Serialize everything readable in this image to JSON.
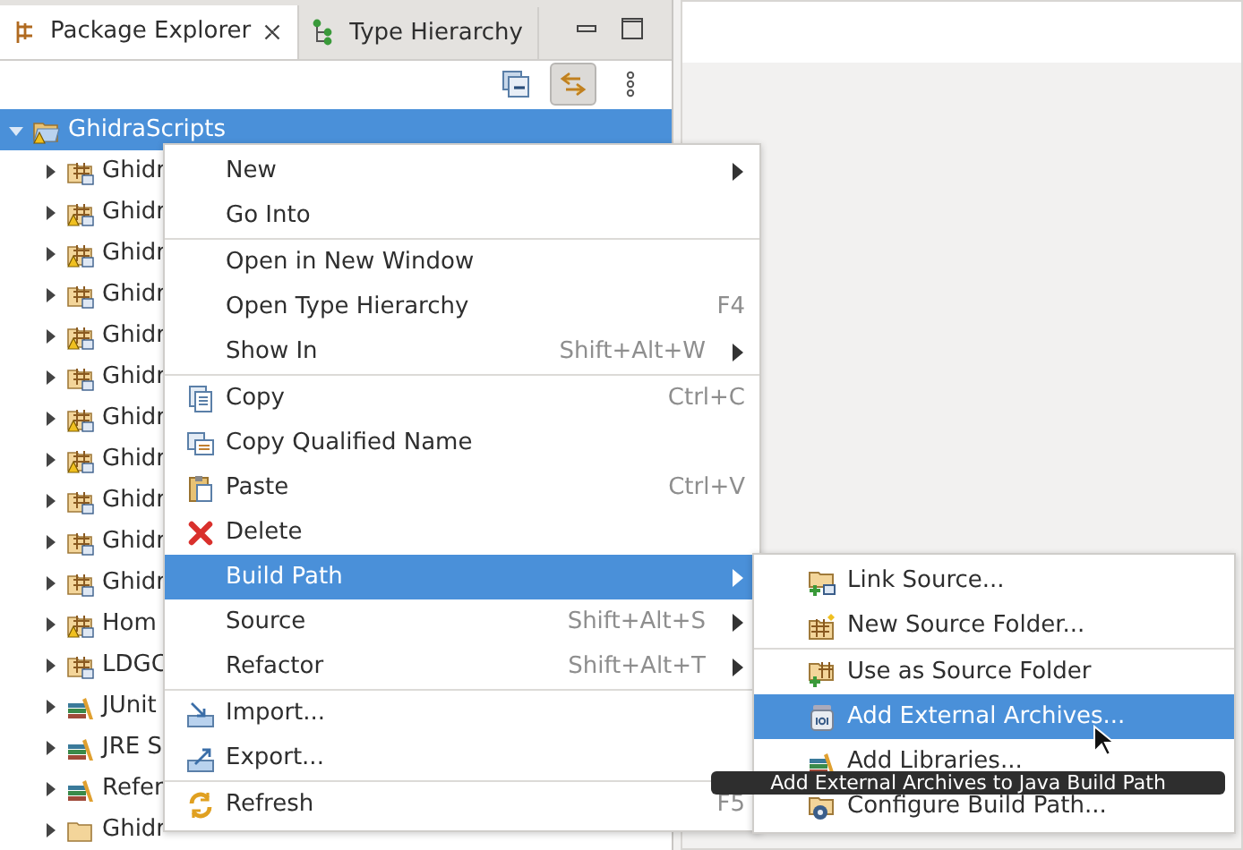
{
  "tabs": [
    {
      "label": "Package Explorer",
      "selected": true
    },
    {
      "label": "Type Hierarchy",
      "selected": false
    }
  ],
  "tree": {
    "label": "GhidraScripts",
    "expanded": true,
    "selected": true,
    "warning": true,
    "children": [
      {
        "label": "Ghidr",
        "kind": "package",
        "warning": false,
        "expanded": false
      },
      {
        "label": "Ghidr",
        "kind": "package",
        "warning": true,
        "expanded": false
      },
      {
        "label": "Ghidr",
        "kind": "package",
        "warning": true,
        "expanded": false
      },
      {
        "label": "Ghidr",
        "kind": "package",
        "warning": false,
        "expanded": false
      },
      {
        "label": "Ghidr",
        "kind": "package",
        "warning": true,
        "expanded": false
      },
      {
        "label": "Ghidr",
        "kind": "package",
        "warning": false,
        "expanded": false
      },
      {
        "label": "Ghidr",
        "kind": "package",
        "warning": true,
        "expanded": false
      },
      {
        "label": "Ghidr",
        "kind": "package",
        "warning": true,
        "expanded": false
      },
      {
        "label": "Ghidr",
        "kind": "package",
        "warning": false,
        "expanded": false
      },
      {
        "label": "Ghidr",
        "kind": "package",
        "warning": false,
        "expanded": false
      },
      {
        "label": "Ghidr",
        "kind": "package",
        "warning": false,
        "expanded": false
      },
      {
        "label": "Hom",
        "kind": "package",
        "warning": true,
        "expanded": false
      },
      {
        "label": "LDGC",
        "kind": "package",
        "warning": false,
        "expanded": false
      },
      {
        "label": "JUnit",
        "kind": "library",
        "warning": false,
        "expanded": false
      },
      {
        "label": "JRE S",
        "kind": "library",
        "warning": false,
        "expanded": false
      },
      {
        "label": "Refer",
        "kind": "library",
        "warning": false,
        "expanded": false
      },
      {
        "label": "Ghidr",
        "kind": "folder",
        "warning": false,
        "expanded": false
      }
    ]
  },
  "context_menu": [
    {
      "kind": "item",
      "label": "New",
      "submenu": true,
      "selected": false
    },
    {
      "kind": "item",
      "label": "Go Into",
      "selected": false
    },
    {
      "kind": "separator"
    },
    {
      "kind": "item",
      "label": "Open in New Window",
      "selected": false
    },
    {
      "kind": "item",
      "label": "Open Type Hierarchy",
      "shortcut": "F4",
      "selected": false
    },
    {
      "kind": "item",
      "label": "Show In",
      "shortcut": "Shift+Alt+W",
      "submenu": true,
      "selected": false
    },
    {
      "kind": "separator"
    },
    {
      "kind": "item",
      "label": "Copy",
      "shortcut": "Ctrl+C",
      "selected": false
    },
    {
      "kind": "item",
      "label": "Copy Qualified Name",
      "selected": false
    },
    {
      "kind": "item",
      "label": "Paste",
      "shortcut": "Ctrl+V",
      "selected": false
    },
    {
      "kind": "item",
      "label": "Delete",
      "selected": false
    },
    {
      "kind": "item",
      "label": "Build Path",
      "submenu": true,
      "selected": true
    },
    {
      "kind": "item",
      "label": "Source",
      "shortcut": "Shift+Alt+S",
      "submenu": true,
      "selected": false
    },
    {
      "kind": "item",
      "label": "Refactor",
      "shortcut": "Shift+Alt+T",
      "submenu": true,
      "selected": false
    },
    {
      "kind": "separator"
    },
    {
      "kind": "item",
      "label": "Import...",
      "selected": false
    },
    {
      "kind": "item",
      "label": "Export...",
      "selected": false
    },
    {
      "kind": "separator"
    },
    {
      "kind": "item",
      "label": "Refresh",
      "shortcut": "F5",
      "selected": false
    }
  ],
  "build_path_menu": [
    {
      "kind": "item",
      "label": "Link Source...",
      "selected": false
    },
    {
      "kind": "item",
      "label": "New Source Folder...",
      "selected": false
    },
    {
      "kind": "separator"
    },
    {
      "kind": "item",
      "label": "Use as Source Folder",
      "selected": false
    },
    {
      "kind": "item",
      "label": "Add External Archives...",
      "selected": true
    },
    {
      "kind": "item",
      "label": "Add Libraries...",
      "selected": false
    },
    {
      "kind": "item",
      "label": "Configure Build Path...",
      "selected": false
    }
  ],
  "tooltip": "Add External Archives to Java Build Path"
}
